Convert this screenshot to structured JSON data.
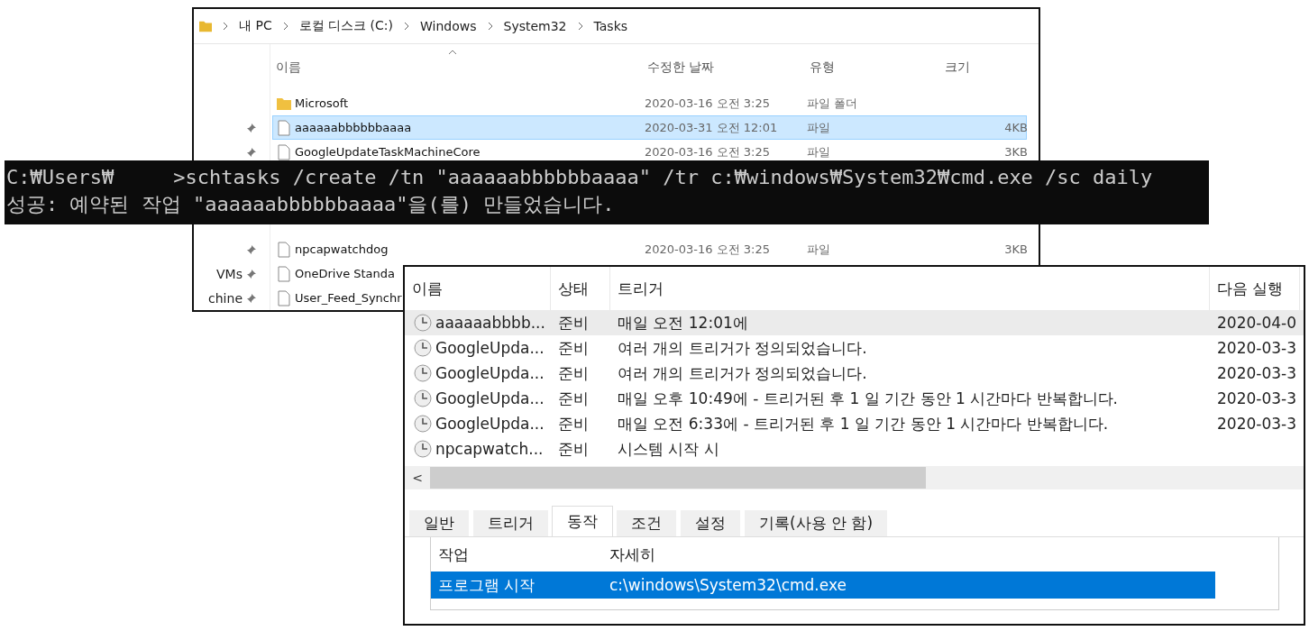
{
  "explorer": {
    "breadcrumb": [
      "내 PC",
      "로컬 디스크 (C:)",
      "Windows",
      "System32",
      "Tasks"
    ],
    "columns": [
      "이름",
      "수정한 날짜",
      "유형",
      "크기"
    ],
    "nav_top": [
      {
        "pinned": false
      },
      {
        "pinned": true
      },
      {
        "pinned": true
      }
    ],
    "rows_top": [
      {
        "kind": "folder",
        "name": "Microsoft",
        "date": "2020-03-16 오전 3:25",
        "type": "파일 폴더",
        "selected": false
      },
      {
        "kind": "file",
        "name": "aaaaaabbbbbbaaaa",
        "date": "2020-03-31 오전 12:01",
        "type": "파일",
        "size": "4KB",
        "selected": true
      },
      {
        "kind": "file",
        "name": "GoogleUpdateTaskMachineCore",
        "date": "2020-03-16 오전 3:25",
        "type": "파일",
        "size": "3KB",
        "selected": false
      }
    ],
    "nav_bottom": [
      {
        "pinned": true
      },
      {
        "label": "VMs",
        "pinned": true
      },
      {
        "label": "chine",
        "pinned": true
      }
    ],
    "rows_bottom": [
      {
        "kind": "file",
        "name": "npcapwatchdog",
        "date": "2020-03-16 오전 3:25",
        "type": "파일",
        "size": "3KB",
        "selected": false
      },
      {
        "kind": "file",
        "name": "OneDrive Standa",
        "selected": false
      },
      {
        "kind": "file",
        "name": "User_Feed_Synchr",
        "selected": false
      }
    ]
  },
  "console": {
    "lines": [
      {
        "prompt": "C:₩Users₩",
        "command": ">schtasks /create /tn \"aaaaaabbbbbbaaaa\" /tr c:₩windows₩System32₩cmd.exe /sc daily"
      },
      {
        "prompt": "성공: 예약된 작업 \"aaaaaabbbbbbaaaa\"을(를) 만들었습니다."
      }
    ]
  },
  "scheduler": {
    "columns": [
      "이름",
      "상태",
      "트리거",
      "다음 실행"
    ],
    "tasks": [
      {
        "name": "aaaaaabbbb...",
        "status": "준비",
        "trigger": "매일 오전 12:01에",
        "next_run": "2020-04-0",
        "selected": true
      },
      {
        "name": "GoogleUpda...",
        "status": "준비",
        "trigger": "여러 개의 트리거가 정의되었습니다.",
        "next_run": "2020-03-3",
        "selected": false
      },
      {
        "name": "GoogleUpda...",
        "status": "준비",
        "trigger": "여러 개의 트리거가 정의되었습니다.",
        "next_run": "2020-03-3",
        "selected": false
      },
      {
        "name": "GoogleUpda...",
        "status": "준비",
        "trigger": "매일 오후 10:49에 - 트리거된 후 1 일 기간 동안 1 시간마다 반복합니다.",
        "next_run": "2020-03-3",
        "selected": false
      },
      {
        "name": "GoogleUpda...",
        "status": "준비",
        "trigger": "매일 오전 6:33에 - 트리거된 후 1 일 기간 동안 1 시간마다 반복합니다.",
        "next_run": "2020-03-3",
        "selected": false
      },
      {
        "name": "npcapwatch...",
        "status": "준비",
        "trigger": "시스템 시작 시",
        "selected": false
      }
    ],
    "scroll_left": "<",
    "tabs": [
      {
        "label": "일반",
        "selected": false
      },
      {
        "label": "트리거",
        "selected": false
      },
      {
        "label": "동작",
        "selected": true
      },
      {
        "label": "조건",
        "selected": false
      },
      {
        "label": "설정",
        "selected": false
      },
      {
        "label": "기록(사용 안 함)",
        "selected": false
      }
    ],
    "action_columns": [
      "작업",
      "자세히"
    ],
    "actions": [
      {
        "action": "프로그램 시작",
        "details": "c:\\windows\\System32\\cmd.exe",
        "selected": true
      }
    ]
  }
}
